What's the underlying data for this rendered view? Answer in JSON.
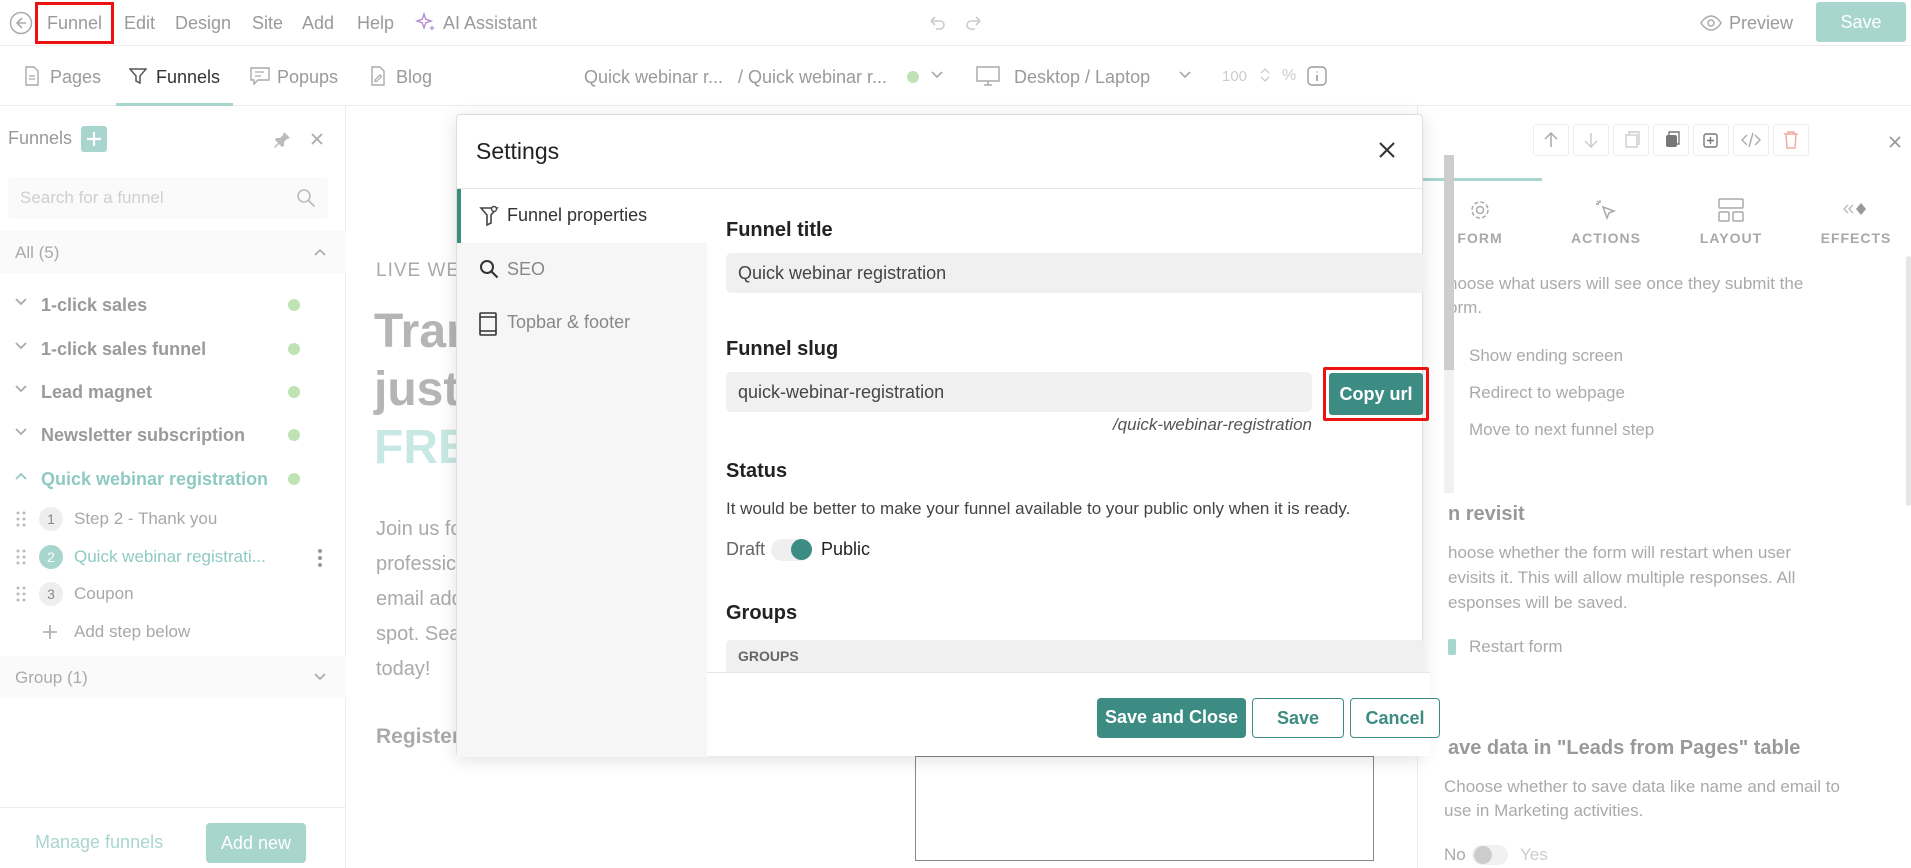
{
  "topmenu": {
    "items": [
      "Funnel",
      "Edit",
      "Design",
      "Site",
      "Add",
      "Help",
      "AI Assistant"
    ],
    "preview": "Preview",
    "save": "Save"
  },
  "subtabs": [
    "Pages",
    "Funnels",
    "Popups",
    "Blog"
  ],
  "breadcrumb": {
    "funnel": "Quick webinar r...",
    "step": "/ Quick webinar r..."
  },
  "device": "Desktop / Laptop",
  "zoom": {
    "value": "100",
    "unit": "%"
  },
  "left": {
    "title": "Funnels",
    "search_placeholder": "Search for a funnel",
    "all_label": "All (5)",
    "funnels": [
      "1-click sales",
      "1-click sales funnel",
      "Lead magnet",
      "Newsletter subscription",
      "Quick webinar registration"
    ],
    "steps": [
      {
        "num": "1",
        "label": "Step 2 - Thank you"
      },
      {
        "num": "2",
        "label": "Quick webinar registrati..."
      },
      {
        "num": "3",
        "label": "Coupon"
      }
    ],
    "add_step": "Add step below",
    "group_label": "Group (1)",
    "manage": "Manage funnels",
    "add_new": "Add new"
  },
  "canvas": {
    "eyebrow": "LIVE WE",
    "h1a": "Trar",
    "h1b": "just",
    "h1c": "FRE",
    "p1": "Join us fo",
    "p2": "professic",
    "p3": "email add",
    "p4": "spot. Sea",
    "p5": "today!",
    "register": "Register"
  },
  "right": {
    "tabs": [
      "FORM",
      "ACTIONS",
      "LAYOUT",
      "EFFECTS"
    ],
    "intro1": "hoose what users will see once they submit the",
    "intro2": "orm.",
    "opt1": "Show ending screen",
    "opt2": "Redirect to webpage",
    "opt3": "Move to next funnel step",
    "revisit_title": "n revisit",
    "revisit1": "hoose whether the form will restart when user",
    "revisit2": "evisits it. This will allow multiple responses. All",
    "revisit3": "esponses will be saved.",
    "restart": "Restart form",
    "save_title": "ave data in \"Leads from Pages\" table",
    "save1": "Choose whether to save data like name and email to",
    "save2": "use in Marketing activities.",
    "no": "No",
    "yes": "Yes"
  },
  "modal": {
    "title": "Settings",
    "nav": [
      "Funnel properties",
      "SEO",
      "Topbar & footer"
    ],
    "funnel_title_label": "Funnel title",
    "funnel_title_value": "Quick webinar registration",
    "slug_label": "Funnel slug",
    "slug_value": "quick-webinar-registration",
    "slug_hint": "/quick-webinar-registration",
    "copy_url": "Copy url",
    "status_label": "Status",
    "status_desc": "It would be better to make your funnel available to your public only when it is ready.",
    "draft": "Draft",
    "public": "Public",
    "groups_label": "Groups",
    "groups_header": "GROUPS",
    "save_close": "Save and Close",
    "save": "Save",
    "cancel": "Cancel"
  },
  "colors": {
    "accent": "#3d8c84",
    "highlight": "#e11111"
  }
}
